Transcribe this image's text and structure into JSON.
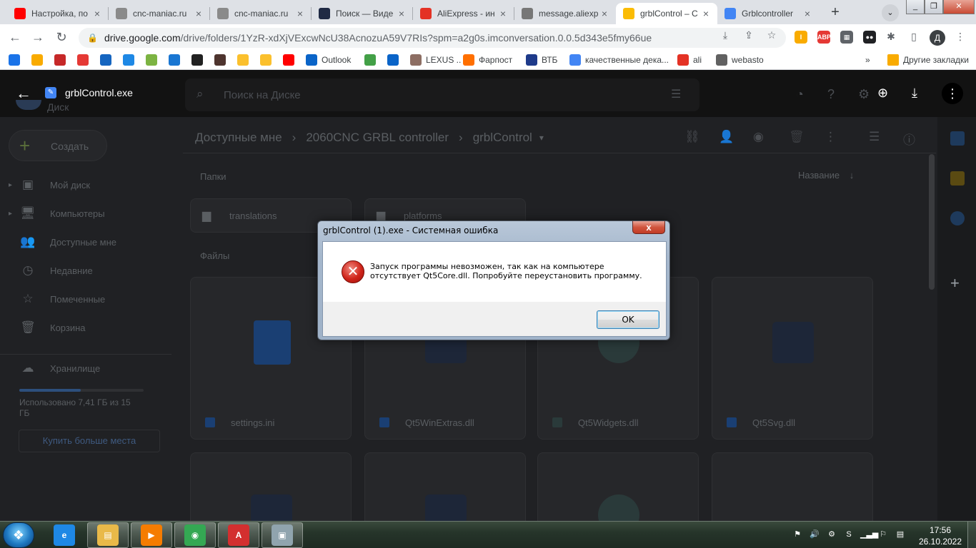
{
  "browser": {
    "tabs": [
      {
        "title": "Настройка, по",
        "icon": "youtube-icon",
        "color": "#ff0000"
      },
      {
        "title": "cnc-maniac.ru",
        "icon": "site-icon",
        "color": "#8a8a8a"
      },
      {
        "title": "cnc-maniac.ru",
        "icon": "site-icon",
        "color": "#8a8a8a"
      },
      {
        "title": "Поиск — Виде",
        "icon": "r-icon",
        "color": "#1f2a44"
      },
      {
        "title": "AliExpress - ин",
        "icon": "aliexpress-icon",
        "color": "#e43225"
      },
      {
        "title": "message.aliexp",
        "icon": "globe-icon",
        "color": "#777777"
      },
      {
        "title": "grblControl – C",
        "icon": "google-drive-icon",
        "color": "#fbbc04"
      },
      {
        "title": "Grblcontroller",
        "icon": "google-docs-icon",
        "color": "#4285f4"
      }
    ],
    "active_tab": 6,
    "url_host": "drive.google.com",
    "url_path": "/drive/folders/1YzR-xdXjVExcwNcU38AcnozuA59V7RIs?spm=a2g0s.imconversation.0.0.5d343e5fmy66ue",
    "profile_letter": "Д",
    "extensions": [
      {
        "label": "I",
        "color": "#f9ab00"
      },
      {
        "label": "ABP",
        "color": "#e53935"
      },
      {
        "label": "▦",
        "color": "#5f6368"
      },
      {
        "label": "●●",
        "color": "#202124"
      }
    ],
    "bookmarks": [
      {
        "label": "",
        "icon": "slash-icon",
        "color": "#1a73e8"
      },
      {
        "label": "",
        "icon": "target-icon",
        "color": "#f9ab00"
      },
      {
        "label": "",
        "icon": "sp-icon",
        "color": "#c62828"
      },
      {
        "label": "",
        "icon": "star-badge-icon",
        "color": "#e53935"
      },
      {
        "label": "",
        "icon": "kb-icon",
        "color": "#1565c0"
      },
      {
        "label": "",
        "icon": "cr-icon",
        "color": "#1e88e5"
      },
      {
        "label": "",
        "icon": "dots-icon",
        "color": "#7cb342"
      },
      {
        "label": "",
        "icon": "24-icon",
        "color": "#1976d2"
      },
      {
        "label": "",
        "icon": "spiral-icon",
        "color": "#212121"
      },
      {
        "label": "",
        "icon": "lg-icon",
        "color": "#4e342e"
      },
      {
        "label": "",
        "icon": "sun-icon",
        "color": "#fbc02d"
      },
      {
        "label": "",
        "icon": "sun-icon",
        "color": "#fbc02d"
      },
      {
        "label": "",
        "icon": "youtube-icon",
        "color": "#ff0000"
      },
      {
        "label": "Outlook",
        "icon": "outlook-icon",
        "color": "#0a64c8"
      },
      {
        "label": "",
        "icon": "check-icon",
        "color": "#43a047"
      },
      {
        "label": "",
        "icon": "outlook-icon",
        "color": "#0a64c8"
      },
      {
        "label": "LEXUS ..",
        "icon": "lexus-icon",
        "color": "#8d6e63"
      },
      {
        "label": "Фарпост",
        "icon": "farpost-icon",
        "color": "#ff6f00"
      },
      {
        "label": "ВТБ",
        "icon": "vtb-icon",
        "color": "#1e3a8a"
      },
      {
        "label": "качественные дека...",
        "icon": "google-icon",
        "color": "#4285f4"
      },
      {
        "label": "ali",
        "icon": "aliexpress-icon",
        "color": "#e43225"
      },
      {
        "label": "webasto",
        "icon": "globe-icon",
        "color": "#616161"
      }
    ],
    "bookmarks_more": "»",
    "other_bookmarks": "Другие закладки"
  },
  "drive": {
    "file_title": "grblControl.exe",
    "search_placeholder": "Поиск на Диске",
    "drive_label": "Диск",
    "create_label": "Создать",
    "breadcrumb": [
      "Доступные мне",
      "2060CNC GRBL controller",
      "grblControl"
    ],
    "sidebar": [
      {
        "label": "Мой диск",
        "icon": "my-drive-icon"
      },
      {
        "label": "Компьютеры",
        "icon": "computers-icon"
      },
      {
        "label": "Доступные мне",
        "icon": "shared-icon"
      },
      {
        "label": "Недавние",
        "icon": "recent-icon"
      },
      {
        "label": "Помеченные",
        "icon": "star-icon"
      },
      {
        "label": "Корзина",
        "icon": "trash-icon"
      }
    ],
    "storage_label": "Хранилище",
    "storage_used_text": "Использовано 7,41 ГБ из 15 ГБ",
    "storage_fraction": 0.494,
    "buy_storage_label": "Купить больше места",
    "folders_header": "Папки",
    "sort_label": "Название",
    "files_header": "Файлы",
    "folders": [
      "translations",
      "platforms"
    ],
    "files": [
      {
        "name": "settings.ini",
        "type": "doc"
      },
      {
        "name": "Qt5WinExtras.dll",
        "type": "exe"
      },
      {
        "name": "Qt5Widgets.dll",
        "type": "search"
      },
      {
        "name": "Qt5Svg.dll",
        "type": "exe"
      }
    ],
    "accent": "#8ab4f8"
  },
  "dialog": {
    "title": "grblControl (1).exe - Системная ошибка",
    "message": "Запуск программы невозможен, так как на компьютере отсутствует Qt5Core.dll. Попробуйте переустановить программу.",
    "ok_label": "OK",
    "close_label": "x"
  },
  "taskbar": {
    "apps": [
      {
        "name": "internet-explorer",
        "label": "e",
        "color": "#1e88e5"
      },
      {
        "name": "explorer",
        "label": "▤",
        "color": "#e9b949"
      },
      {
        "name": "media-player",
        "label": "▶",
        "color": "#f57c00"
      },
      {
        "name": "chrome",
        "label": "◉",
        "color": "#34a853"
      },
      {
        "name": "acrobat",
        "label": "A",
        "color": "#d32f2f"
      },
      {
        "name": "window-app",
        "label": "▣",
        "color": "#90a4ae"
      }
    ],
    "time": "17:56",
    "date": "26.10.2022"
  }
}
